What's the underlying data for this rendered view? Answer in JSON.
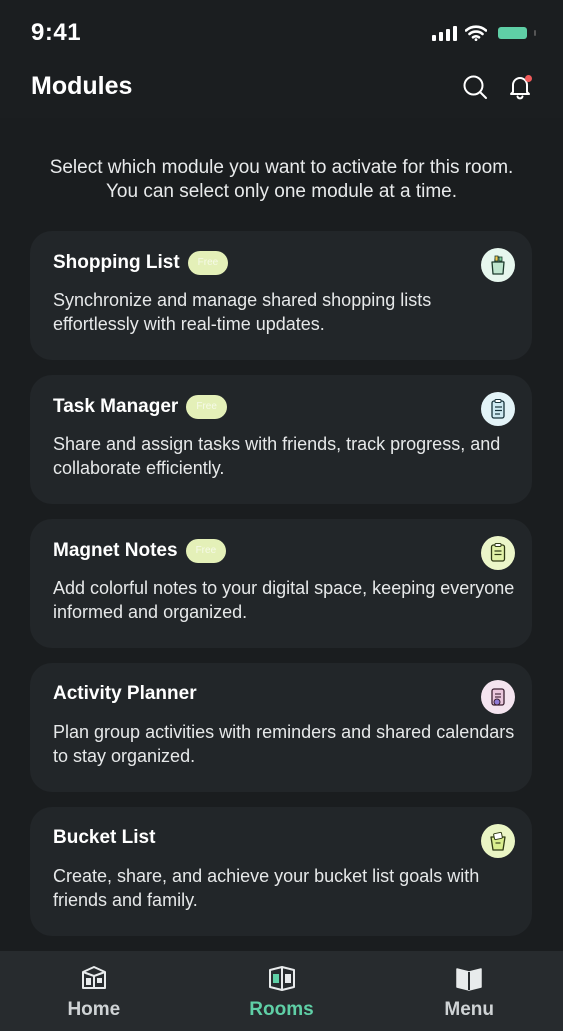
{
  "status_bar": {
    "time": "9:41"
  },
  "header": {
    "title": "Modules"
  },
  "intro": {
    "line1": "Select which module you want to activate for this room.",
    "line2": "You can select only one module at a time."
  },
  "modules": [
    {
      "title": "Shopping List",
      "badge": "Free",
      "description": "Synchronize and manage shared shopping lists effortlessly with real-time updates.",
      "icon": "shopping-bag-icon",
      "icon_bg": "#e7f7ee"
    },
    {
      "title": "Task Manager",
      "badge": "Free",
      "description": "Share and assign tasks with friends, track progress, and collaborate efficiently.",
      "icon": "clipboard-list-icon",
      "icon_bg": "#e3f3f7"
    },
    {
      "title": "Magnet Notes",
      "badge": "Free",
      "description": "Add colorful notes to your digital space, keeping everyone informed and organized.",
      "icon": "note-icon",
      "icon_bg": "#ecf6c9"
    },
    {
      "title": "Activity Planner",
      "description": "Plan group activities with reminders and shared calendars to stay organized.",
      "icon": "planner-icon",
      "icon_bg": "#f4e4ef"
    },
    {
      "title": "Bucket List",
      "description": "Create, share, and achieve your bucket list goals with friends and family.",
      "icon": "bucket-icon",
      "icon_bg": "#eaf5c4"
    }
  ],
  "tabs": [
    {
      "label": "Home",
      "icon": "home-icon",
      "active": false
    },
    {
      "label": "Rooms",
      "icon": "rooms-icon",
      "active": true
    },
    {
      "label": "Menu",
      "icon": "menu-book-icon",
      "active": false
    }
  ],
  "colors": {
    "accent": "#5fcfa6",
    "card": "#222629",
    "notification": "#f05a5a",
    "badge": "#e4f0b8"
  }
}
